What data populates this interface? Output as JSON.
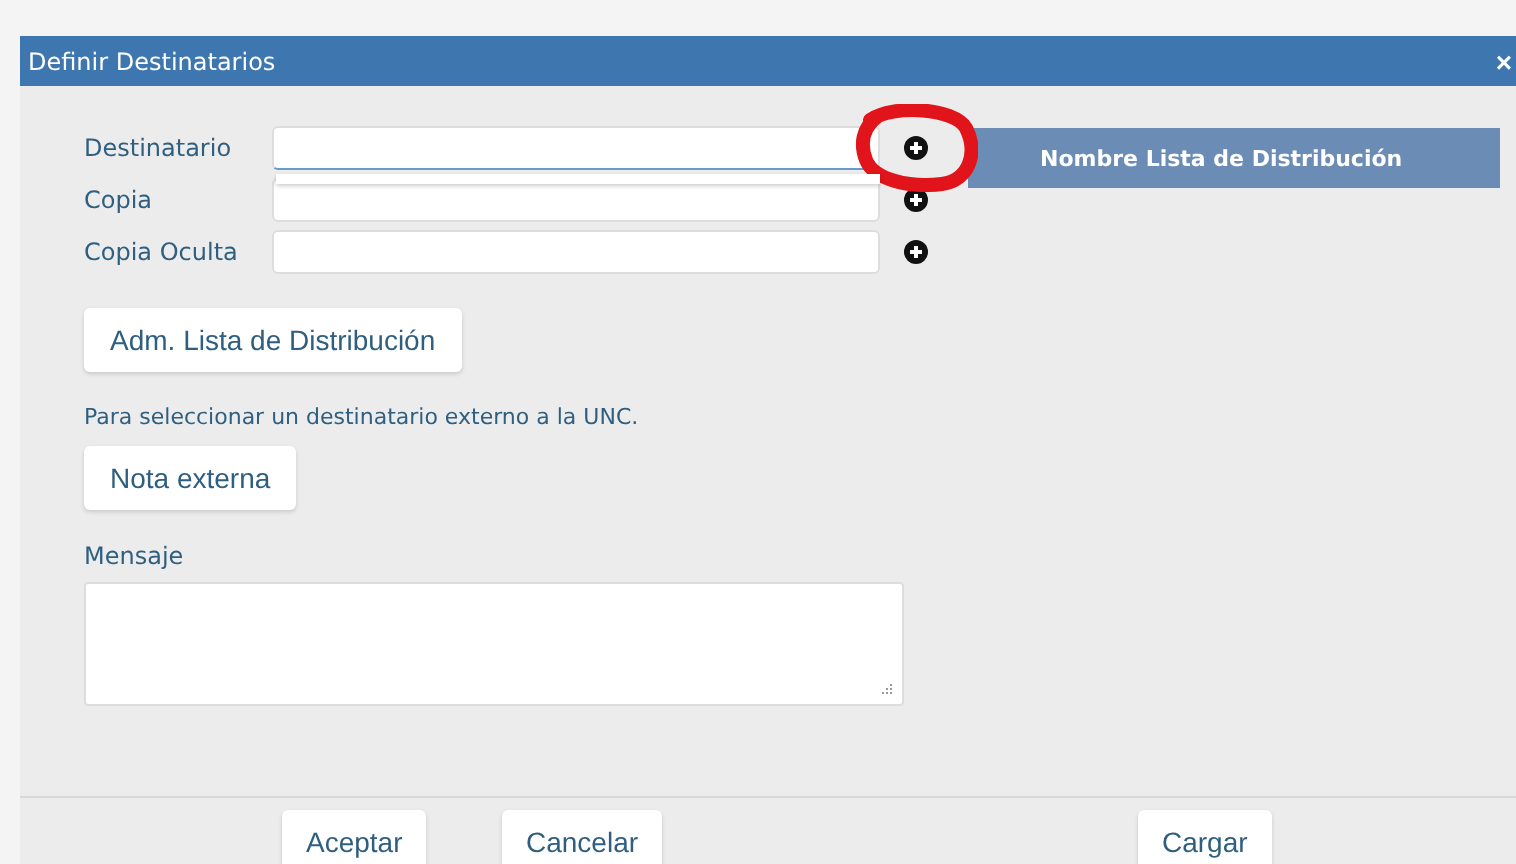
{
  "dialog": {
    "title": "Definir Destinatarios",
    "close": "×"
  },
  "fields": [
    {
      "label": "Destinatario",
      "focused": true
    },
    {
      "label": "Copia",
      "focused": false
    },
    {
      "label": "Copia Oculta",
      "focused": false
    }
  ],
  "list_panel": {
    "header": "Nombre Lista de Distribución"
  },
  "manage_button": "Adm. Lista de Distribución",
  "external_hint": "Para seleccionar un destinatario externo a la UNC.",
  "external_button": "Nota externa",
  "message": {
    "label": "Mensaje"
  },
  "footer_buttons": [
    "Aceptar",
    "Cancelar",
    "Cargar"
  ]
}
